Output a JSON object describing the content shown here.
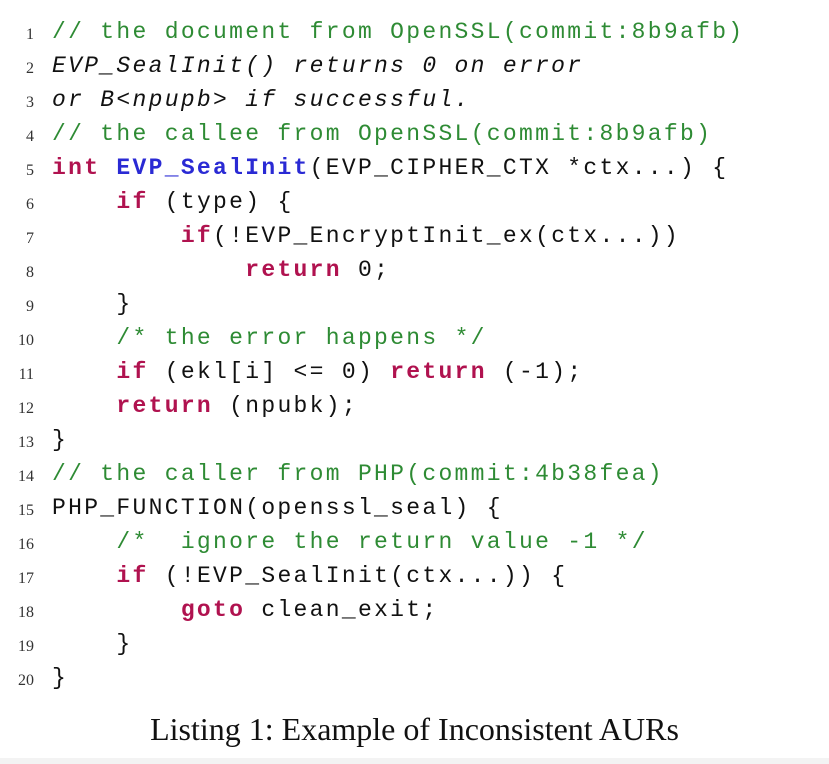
{
  "listing": {
    "lines": [
      {
        "num": "1",
        "tokens": [
          {
            "t": "// the document from OpenSSL(commit:8b9afb)",
            "c": "comment"
          }
        ]
      },
      {
        "num": "2",
        "tokens": [
          {
            "t": "EVP_SealInit() returns 0 on error",
            "c": "comment-it"
          }
        ]
      },
      {
        "num": "3",
        "tokens": [
          {
            "t": "or B<npupb> if successful.",
            "c": "comment-it"
          }
        ]
      },
      {
        "num": "4",
        "tokens": [
          {
            "t": "// the callee from OpenSSL(commit:8b9afb)",
            "c": "comment"
          }
        ]
      },
      {
        "num": "5",
        "tokens": [
          {
            "t": "int ",
            "c": "kw"
          },
          {
            "t": "EVP_SealInit",
            "c": "fn"
          },
          {
            "t": "(EVP_CIPHER_CTX *ctx...) {",
            "c": "plain"
          }
        ]
      },
      {
        "num": "6",
        "tokens": [
          {
            "t": "    ",
            "c": "plain"
          },
          {
            "t": "if",
            "c": "kw"
          },
          {
            "t": " (type) {",
            "c": "plain"
          }
        ]
      },
      {
        "num": "7",
        "tokens": [
          {
            "t": "        ",
            "c": "plain"
          },
          {
            "t": "if",
            "c": "kw"
          },
          {
            "t": "(!EVP_EncryptInit_ex(ctx...))",
            "c": "plain"
          }
        ]
      },
      {
        "num": "8",
        "tokens": [
          {
            "t": "            ",
            "c": "plain"
          },
          {
            "t": "return",
            "c": "kw"
          },
          {
            "t": " 0;",
            "c": "plain"
          }
        ]
      },
      {
        "num": "9",
        "tokens": [
          {
            "t": "    }",
            "c": "plain"
          }
        ]
      },
      {
        "num": "10",
        "tokens": [
          {
            "t": "    ",
            "c": "plain"
          },
          {
            "t": "/* the error happens */",
            "c": "comment"
          }
        ]
      },
      {
        "num": "11",
        "tokens": [
          {
            "t": "    ",
            "c": "plain"
          },
          {
            "t": "if",
            "c": "kw"
          },
          {
            "t": " (ekl[i] <= 0) ",
            "c": "plain"
          },
          {
            "t": "return",
            "c": "kw"
          },
          {
            "t": " (-1);",
            "c": "plain"
          }
        ]
      },
      {
        "num": "12",
        "tokens": [
          {
            "t": "    ",
            "c": "plain"
          },
          {
            "t": "return",
            "c": "kw"
          },
          {
            "t": " (npubk);",
            "c": "plain"
          }
        ]
      },
      {
        "num": "13",
        "tokens": [
          {
            "t": "}",
            "c": "plain"
          }
        ]
      },
      {
        "num": "14",
        "tokens": [
          {
            "t": "// the caller from PHP(commit:4b38fea)",
            "c": "comment"
          }
        ]
      },
      {
        "num": "15",
        "tokens": [
          {
            "t": "PHP_FUNCTION(openssl_seal) {",
            "c": "plain"
          }
        ]
      },
      {
        "num": "16",
        "tokens": [
          {
            "t": "    ",
            "c": "plain"
          },
          {
            "t": "/*  ignore the return value -1 */",
            "c": "comment"
          }
        ]
      },
      {
        "num": "17",
        "tokens": [
          {
            "t": "    ",
            "c": "plain"
          },
          {
            "t": "if",
            "c": "kw"
          },
          {
            "t": " (!EVP_SealInit(ctx...)) {",
            "c": "plain"
          }
        ]
      },
      {
        "num": "18",
        "tokens": [
          {
            "t": "        ",
            "c": "plain"
          },
          {
            "t": "goto",
            "c": "kw"
          },
          {
            "t": " clean_exit;",
            "c": "plain"
          }
        ]
      },
      {
        "num": "19",
        "tokens": [
          {
            "t": "    }",
            "c": "plain"
          }
        ]
      },
      {
        "num": "20",
        "tokens": [
          {
            "t": "}",
            "c": "plain"
          }
        ]
      }
    ]
  },
  "caption": "Listing 1: Example of Inconsistent AURs",
  "colors": {
    "comment": "#2e8b34",
    "keyword": "#b0124f",
    "function_name": "#2a2ad4",
    "text": "#111111"
  }
}
